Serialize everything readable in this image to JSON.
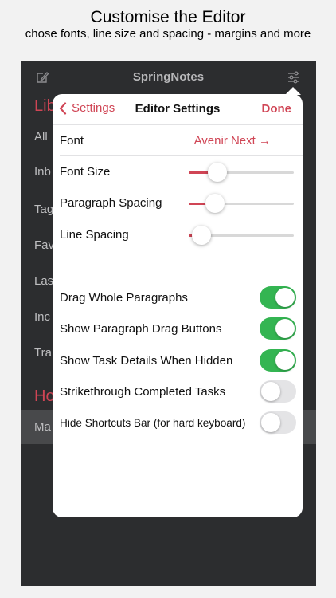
{
  "promo": {
    "title": "Customise the Editor",
    "subtitle": "chose fonts, line size and spacing - margins and more"
  },
  "app": {
    "title": "SpringNotes",
    "left_icon": "compose-icon",
    "right_icon": "sliders-icon"
  },
  "sidebar": {
    "heading_1": "Lib",
    "items": [
      "All",
      "Inb",
      "Tag",
      "Fav",
      "Las",
      "Inc",
      "Tra"
    ],
    "heading_2": "Ho",
    "selected_item": "Ma"
  },
  "popover": {
    "back_label": "Settings",
    "title": "Editor Settings",
    "done_label": "Done",
    "font": {
      "label": "Font",
      "value": "Avenir Next →"
    },
    "sliders": [
      {
        "label": "Font Size",
        "value": 0.27
      },
      {
        "label": "Paragraph Spacing",
        "value": 0.25
      },
      {
        "label": "Line Spacing",
        "value": 0.12
      }
    ],
    "toggles": [
      {
        "label": "Drag Whole Paragraphs",
        "on": true
      },
      {
        "label": "Show Paragraph Drag Buttons",
        "on": true
      },
      {
        "label": "Show Task Details When Hidden",
        "on": true
      },
      {
        "label": "Strikethrough Completed Tasks",
        "on": false
      },
      {
        "label": "Hide Shortcuts Bar (for hard keyboard)",
        "on": false
      }
    ]
  },
  "colors": {
    "accent": "#d04555",
    "toggle_on": "#34b552",
    "toggle_off": "#e4e4e6",
    "background_dark": "#2c2d2f"
  }
}
